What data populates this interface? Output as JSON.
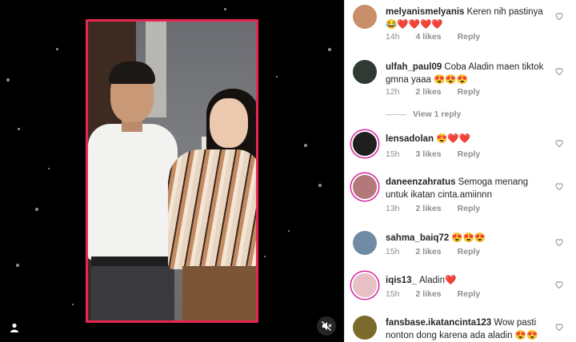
{
  "comments": [
    {
      "username": "melyanismelyanis",
      "text": "Keren nih pastinya 😂❤️❤️❤️❤️",
      "time": "14h",
      "likes": "4 likes",
      "reply": "Reply",
      "avatar_color": "#c98f6a"
    },
    {
      "username": "ulfah_paul09",
      "text": "Coba Aladin maen tiktok gmna yaaa 😍😍😍",
      "time": "12h",
      "likes": "2 likes",
      "reply": "Reply",
      "avatar_color": "#2f3a33"
    },
    {
      "username": "lensadolan",
      "text": "😍❤️❤️",
      "time": "15h",
      "likes": "3 likes",
      "reply": "Reply",
      "avatar_color": "#1f1f1f"
    },
    {
      "username": "daneenzahratus",
      "text": "Semoga menang untuk ikatan cinta.amiinnn",
      "time": "13h",
      "likes": "2 likes",
      "reply": "Reply",
      "avatar_color": "#b5787a"
    },
    {
      "username": "sahma_baiq72",
      "text": "😍😍😍",
      "time": "15h",
      "likes": "2 likes",
      "reply": "Reply",
      "avatar_color": "#6f8ba6"
    },
    {
      "username": "iqis13_",
      "text": "Aladin❤️",
      "time": "15h",
      "likes": "2 likes",
      "reply": "Reply",
      "avatar_color": "#e6c0c4"
    },
    {
      "username": "fansbase.ikatancinta123",
      "text": "Wow pasti nonton dong karena ada aladin 😍😍",
      "time": "",
      "likes": "",
      "reply": "",
      "avatar_color": "#7a6a2c"
    }
  ],
  "view_replies": "View 1 reply",
  "icons": {
    "heart": "heart-outline-icon",
    "user_tag": "user-tag-icon",
    "mute": "sound-off-icon"
  },
  "colors": {
    "frame_border": "#e8264f",
    "text": "#262626",
    "meta": "#8e8e8e"
  }
}
